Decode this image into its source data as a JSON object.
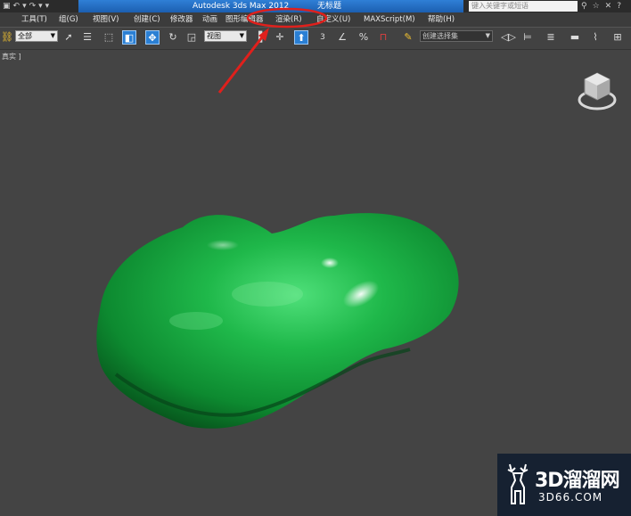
{
  "titlebar": {
    "app_title": "Autodesk 3ds Max  2012",
    "doc_title": "无标题",
    "search_placeholder": "键入关键字或短语"
  },
  "menu": {
    "items": [
      "工具(T)",
      "组(G)",
      "视图(V)",
      "创建(C)",
      "修改器",
      "动画",
      "图形编辑器",
      "渲染(R)",
      "自定义(U)",
      "MAXScript(M)",
      "帮助(H)"
    ]
  },
  "toolbar": {
    "selection_filter": "全部",
    "coordinate_system": "视图",
    "named_selection_set": "创建选择集",
    "snap_label": "3"
  },
  "viewport": {
    "label": "真实 ]",
    "object": "jade-stone"
  },
  "annotation": {
    "color": "#e0201c",
    "target": "渲染(R)"
  },
  "watermark": {
    "title": "3D溜溜网",
    "url": "3D66.COM"
  }
}
